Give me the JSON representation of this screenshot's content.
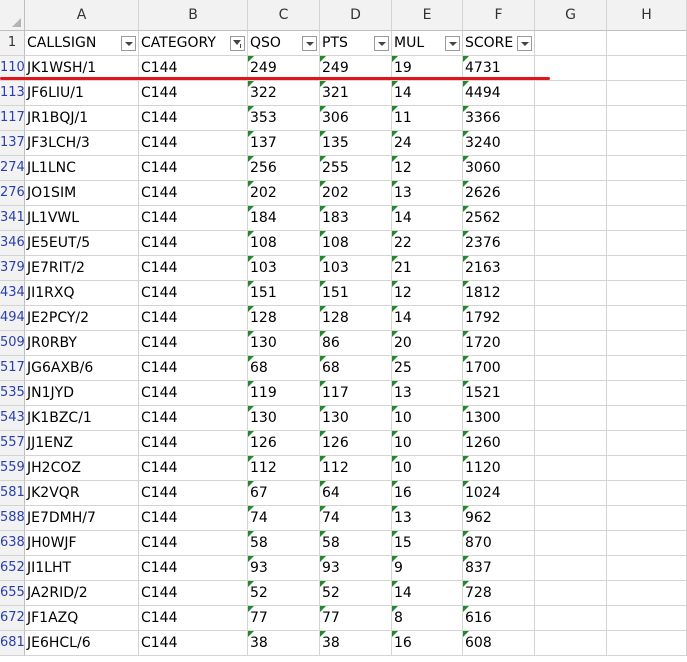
{
  "columns": [
    "A",
    "B",
    "C",
    "D",
    "E",
    "F",
    "G",
    "H"
  ],
  "headerRowNumber": "1",
  "headers": [
    "CALLSIGN",
    "CATEGORY",
    "QSO",
    "PTS",
    "MUL",
    "SCORE"
  ],
  "activeFilterColumn": "CATEGORY",
  "rows": [
    {
      "rownum": "110",
      "callsign": "JK1WSH/1",
      "category": "C144",
      "qso": "249",
      "pts": "249",
      "mul": "19",
      "score": "4731"
    },
    {
      "rownum": "113",
      "callsign": "JF6LIU/1",
      "category": "C144",
      "qso": "322",
      "pts": "321",
      "mul": "14",
      "score": "4494"
    },
    {
      "rownum": "117",
      "callsign": "JR1BQJ/1",
      "category": "C144",
      "qso": "353",
      "pts": "306",
      "mul": "11",
      "score": "3366"
    },
    {
      "rownum": "137",
      "callsign": "JF3LCH/3",
      "category": "C144",
      "qso": "137",
      "pts": "135",
      "mul": "24",
      "score": "3240"
    },
    {
      "rownum": "274",
      "callsign": "JL1LNC",
      "category": "C144",
      "qso": "256",
      "pts": "255",
      "mul": "12",
      "score": "3060"
    },
    {
      "rownum": "276",
      "callsign": "JO1SIM",
      "category": "C144",
      "qso": "202",
      "pts": "202",
      "mul": "13",
      "score": "2626"
    },
    {
      "rownum": "341",
      "callsign": "JL1VWL",
      "category": "C144",
      "qso": "184",
      "pts": "183",
      "mul": "14",
      "score": "2562"
    },
    {
      "rownum": "346",
      "callsign": "JE5EUT/5",
      "category": "C144",
      "qso": "108",
      "pts": "108",
      "mul": "22",
      "score": "2376"
    },
    {
      "rownum": "379",
      "callsign": "JE7RIT/2",
      "category": "C144",
      "qso": "103",
      "pts": "103",
      "mul": "21",
      "score": "2163"
    },
    {
      "rownum": "434",
      "callsign": "JI1RXQ",
      "category": "C144",
      "qso": "151",
      "pts": "151",
      "mul": "12",
      "score": "1812"
    },
    {
      "rownum": "494",
      "callsign": "JE2PCY/2",
      "category": "C144",
      "qso": "128",
      "pts": "128",
      "mul": "14",
      "score": "1792"
    },
    {
      "rownum": "509",
      "callsign": "JR0RBY",
      "category": "C144",
      "qso": "130",
      "pts": "86",
      "mul": "20",
      "score": "1720"
    },
    {
      "rownum": "517",
      "callsign": "JG6AXB/6",
      "category": "C144",
      "qso": "68",
      "pts": "68",
      "mul": "25",
      "score": "1700"
    },
    {
      "rownum": "535",
      "callsign": "JN1JYD",
      "category": "C144",
      "qso": "119",
      "pts": "117",
      "mul": "13",
      "score": "1521"
    },
    {
      "rownum": "543",
      "callsign": "JK1BZC/1",
      "category": "C144",
      "qso": "130",
      "pts": "130",
      "mul": "10",
      "score": "1300"
    },
    {
      "rownum": "557",
      "callsign": "JJ1ENZ",
      "category": "C144",
      "qso": "126",
      "pts": "126",
      "mul": "10",
      "score": "1260"
    },
    {
      "rownum": "559",
      "callsign": "JH2COZ",
      "category": "C144",
      "qso": "112",
      "pts": "112",
      "mul": "10",
      "score": "1120"
    },
    {
      "rownum": "581",
      "callsign": "JK2VQR",
      "category": "C144",
      "qso": "67",
      "pts": "64",
      "mul": "16",
      "score": "1024"
    },
    {
      "rownum": "588",
      "callsign": "JE7DMH/7",
      "category": "C144",
      "qso": "74",
      "pts": "74",
      "mul": "13",
      "score": "962"
    },
    {
      "rownum": "638",
      "callsign": "JH0WJF",
      "category": "C144",
      "qso": "58",
      "pts": "58",
      "mul": "15",
      "score": "870"
    },
    {
      "rownum": "652",
      "callsign": "JI1LHT",
      "category": "C144",
      "qso": "93",
      "pts": "93",
      "mul": "9",
      "score": "837"
    },
    {
      "rownum": "655",
      "callsign": "JA2RID/2",
      "category": "C144",
      "qso": "52",
      "pts": "52",
      "mul": "14",
      "score": "728"
    },
    {
      "rownum": "672",
      "callsign": "JF1AZQ",
      "category": "C144",
      "qso": "77",
      "pts": "77",
      "mul": "8",
      "score": "616"
    },
    {
      "rownum": "681",
      "callsign": "JE6HCL/6",
      "category": "C144",
      "qso": "38",
      "pts": "38",
      "mul": "16",
      "score": "608"
    }
  ],
  "colors": {
    "highlight_line": "#e0151b",
    "number_stored_as_text_marker": "#1f8a2c",
    "row_number_text": "#2a3fae"
  }
}
